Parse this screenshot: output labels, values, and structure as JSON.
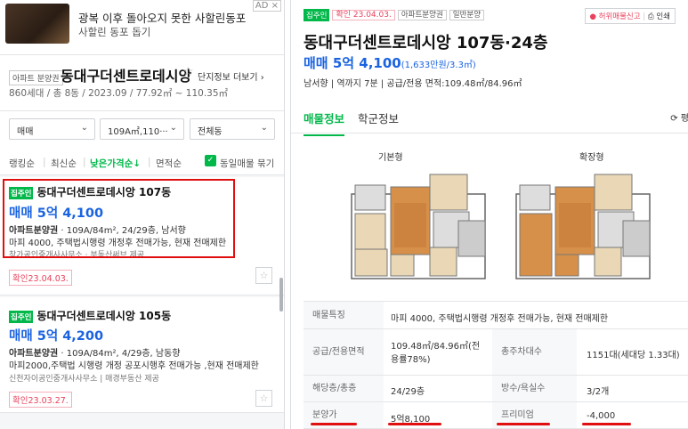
{
  "ad": {
    "badge": "AD ×",
    "line1": "광복 이후 돌아오지 못한 사할린동포",
    "line2": "사할린 동포 돕기"
  },
  "complex": {
    "tag": "아파트 분양권",
    "name": "동대구더센트로데시앙",
    "star": "☆",
    "more_label": "단지정보 더보기",
    "meta": "860세대 / 총 8동 / 2023.09 / 77.92㎡ ~ 110.35㎡"
  },
  "filters": [
    {
      "label": "매매"
    },
    {
      "label": "109A㎡,110···"
    },
    {
      "label": "전체동"
    }
  ],
  "sorts": {
    "ranking": "랭킹순",
    "latest": "최신순",
    "low_price": "낮은가격순↓",
    "area": "면적순",
    "group_label": "동일매물 묶기"
  },
  "listings": [
    {
      "badge": "집주인",
      "title": "동대구더센트로데시앙 107동",
      "price": "매매 5억 4,100",
      "type": "아파트분양권",
      "details": "109A/84m², 24/29층, 남서향",
      "desc": "마피 4000, 주택법시행령 개정후 전매가능, 현재 전매제한",
      "agent": "창가공인중개사사무소 · 부동산써브 제공",
      "confirm": "확인23.04.03."
    },
    {
      "badge": "집주인",
      "title": "동대구더센트로데시앙 105동",
      "price": "매매 5억 4,200",
      "type": "아파트분양권",
      "details": "109A/84m², 4/29층, 남동향",
      "desc": "마피2000,주택법 시행령 개정 공포시행후 전매가능 ,현재 전매제한",
      "agent": "신천자이공인중개사사무소 | 매경부동산 제공",
      "confirm": "확인23.03.27."
    }
  ],
  "detail": {
    "badge": "집주인",
    "confirm": "확인 23.04.03.",
    "tags": [
      "아파트분양권",
      "일반분양"
    ],
    "report": "허위매물신고",
    "print": "인쇄",
    "title": "동대구더센트로데시앙 107동·24층",
    "price": "매매 5억 4,100",
    "price_sub": "(1,633만원/3.3㎡)",
    "meta": "남서향  |  역까지 7분  |  공급/전용 면적:109.48㎡/84.96㎡",
    "tabs": [
      "매물정보",
      "학군정보"
    ],
    "refresh": "⟳ 평",
    "plan_labels": [
      "기본형",
      "확장형"
    ],
    "table": {
      "features_k": "매물특징",
      "features_v": "마피 4000, 주택법시행령 개정후 전매가능, 현재 전매제한",
      "area_k": "공급/전용면적",
      "area_v1": "109.48㎡/84.96㎡(전",
      "area_v2": "용률78%)",
      "parking_k": "총주차대수",
      "parking_v": "1151대(세대당 1.33대)",
      "floor_k": "해당층/총층",
      "floor_v": "24/29층",
      "rooms_k": "방수/욕실수",
      "rooms_v": "3/2개",
      "sale_k": "분양가",
      "sale_v": "5억8,100",
      "prem_k": "프리미엄",
      "prem_v": "-4,000"
    }
  },
  "colors": {
    "green": "#03b84b",
    "blue": "#1a63e0",
    "red": "#e01010"
  }
}
